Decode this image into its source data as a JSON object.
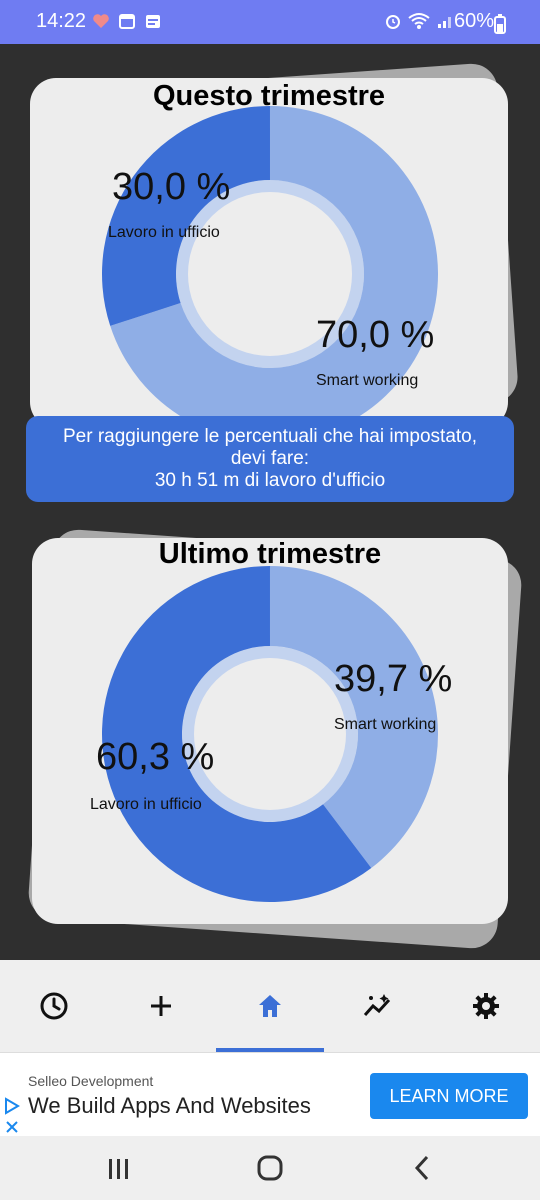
{
  "status_bar": {
    "time": "14:22",
    "battery": "60%"
  },
  "colors": {
    "accent": "#3c6fd6",
    "light_segment": "#8faee6",
    "inner_ring": "#c3d3ef",
    "card_bg": "#ededed",
    "app_bg": "#2f2f2f"
  },
  "quarter_current": {
    "title": "Questo trimestre",
    "office_pct": 30.0,
    "smart_pct": 70.0,
    "office_value": "30,0 %",
    "office_label": "Lavoro in ufficio",
    "smart_value": "70,0 %",
    "smart_label": "Smart working"
  },
  "info": {
    "line1": "Per raggiungere le percentuali che hai impostato,",
    "line2": "devi fare:",
    "line3": "30 h 51 m di lavoro d'ufficio"
  },
  "quarter_last": {
    "title": "Ultimo trimestre",
    "office_pct": 60.3,
    "smart_pct": 39.7,
    "smart_value": "39,7 %",
    "smart_label": "Smart working",
    "office_value": "60,3 %",
    "office_label": "Lavoro in ufficio"
  },
  "nav": {
    "items": [
      {
        "icon": "clock-icon"
      },
      {
        "icon": "plus-icon"
      },
      {
        "icon": "home-icon",
        "active": true
      },
      {
        "icon": "trend-sparkle-icon"
      },
      {
        "icon": "gear-icon"
      }
    ]
  },
  "ad": {
    "advertiser": "Selleo Development",
    "headline": "We Build Apps And Websites",
    "cta": "LEARN MORE"
  }
}
